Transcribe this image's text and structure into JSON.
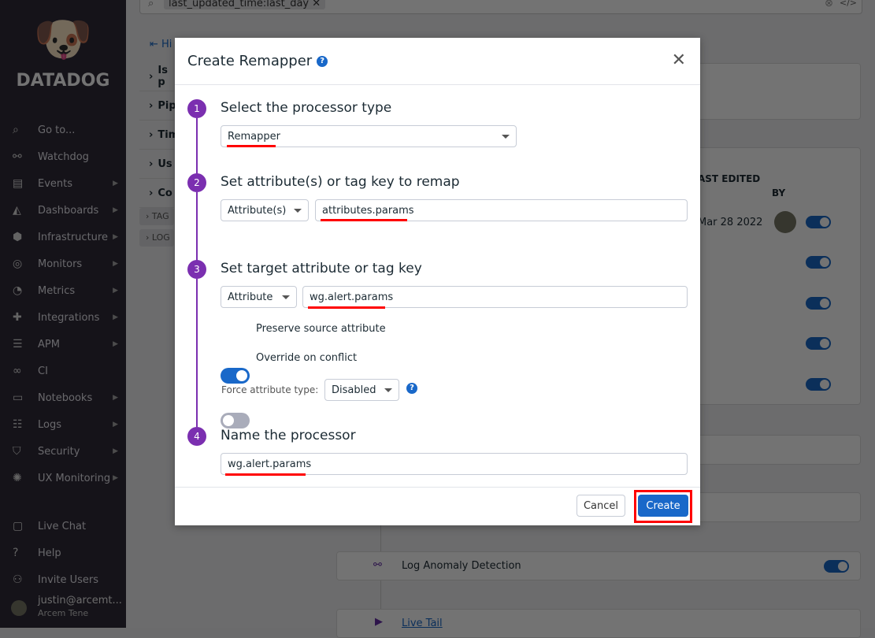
{
  "sidebar": {
    "brand": "DATADOG",
    "items": [
      {
        "label": "Go to...",
        "icon": "search-icon",
        "glyph": "⌕"
      },
      {
        "label": "Watchdog",
        "icon": "binoculars-icon",
        "glyph": "⚯"
      },
      {
        "label": "Events",
        "icon": "events-icon",
        "glyph": "▤",
        "arrow": true
      },
      {
        "label": "Dashboards",
        "icon": "dashboards-icon",
        "glyph": "◭",
        "arrow": true
      },
      {
        "label": "Infrastructure",
        "icon": "infrastructure-icon",
        "glyph": "⬢",
        "arrow": true
      },
      {
        "label": "Monitors",
        "icon": "monitors-icon",
        "glyph": "◎",
        "arrow": true
      },
      {
        "label": "Metrics",
        "icon": "metrics-icon",
        "glyph": "◔",
        "arrow": true
      },
      {
        "label": "Integrations",
        "icon": "puzzle-icon",
        "glyph": "✚",
        "arrow": true
      },
      {
        "label": "APM",
        "icon": "apm-icon",
        "glyph": "☰",
        "arrow": true
      },
      {
        "label": "CI",
        "icon": "ci-icon",
        "glyph": "∞"
      },
      {
        "label": "Notebooks",
        "icon": "notebook-icon",
        "glyph": "▭",
        "arrow": true
      },
      {
        "label": "Logs",
        "icon": "logs-icon",
        "glyph": "☷",
        "arrow": true
      },
      {
        "label": "Security",
        "icon": "shield-icon",
        "glyph": "⛉",
        "arrow": true
      },
      {
        "label": "UX Monitoring",
        "icon": "ux-icon",
        "glyph": "✺",
        "arrow": true
      }
    ],
    "bottom": [
      {
        "label": "Live Chat",
        "icon": "chat-icon",
        "glyph": "▢"
      },
      {
        "label": "Help",
        "icon": "help-icon",
        "glyph": "?"
      },
      {
        "label": "Invite Users",
        "icon": "users-icon",
        "glyph": "⚇"
      }
    ],
    "user": {
      "email": "justin@arcemt...",
      "org": "Arcem Tene"
    }
  },
  "background": {
    "search_query": "last_updated_time:last_day",
    "hide_label": "Hi",
    "rows": [
      "Is p",
      "Pip",
      "Tim",
      "Us",
      "Co"
    ],
    "chips": [
      "TAG",
      "LOG"
    ],
    "table": {
      "col_last_edited": "AST EDITED",
      "col_by": "BY",
      "date": "Mar 28 2022"
    },
    "cards": [
      {
        "label": "Log Anomaly Detection"
      },
      {
        "label": "Live Tail"
      }
    ]
  },
  "modal": {
    "title": "Create Remapper",
    "steps": [
      {
        "num": "1",
        "title": "Select the processor type",
        "select": "Remapper"
      },
      {
        "num": "2",
        "title": "Set attribute(s) or tag key to remap",
        "select": "Attribute(s)",
        "input": "attributes.params"
      },
      {
        "num": "3",
        "title": "Set target attribute or tag key",
        "select": "Attribute",
        "input": "wg.alert.params",
        "preserve_label": "Preserve source attribute",
        "preserve_on": true,
        "override_label": "Override on conflict",
        "override_on": false,
        "force_label": "Force attribute type:",
        "force_value": "Disabled"
      },
      {
        "num": "4",
        "title": "Name the processor",
        "input": "wg.alert.params"
      }
    ],
    "cancel": "Cancel",
    "create": "Create"
  },
  "colors": {
    "accent": "#1968c9",
    "step": "#7b2fb0",
    "highlight": "#ff0000"
  }
}
